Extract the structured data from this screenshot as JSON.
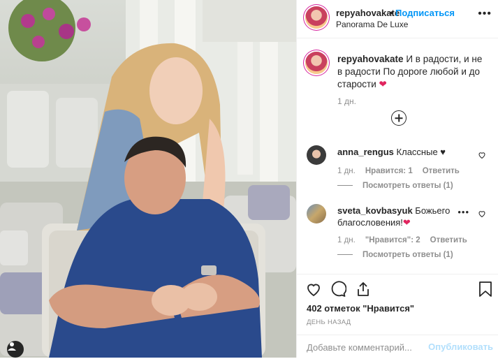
{
  "post": {
    "username": "repyahovakate",
    "separator": "•",
    "follow_label": "Подписаться",
    "location": "Panorama De Luxe",
    "more_icon": "more-dots-icon"
  },
  "caption": {
    "username": "repyahovakate",
    "text": " И в радости, и не в радости По дороге любой и до старости ",
    "emoji": "❤",
    "time": "1 дн.",
    "heart_color": "#e0245e"
  },
  "comments": [
    {
      "username": "anna_rengus",
      "text": " Классные ♥",
      "time": "1 дн.",
      "likes": "Нравится: 1",
      "reply": "Ответить",
      "view_replies": "Посмотреть ответы (1)"
    },
    {
      "username": "sveta_kovbasyuk",
      "text": " Божьего благословения!",
      "emoji": "❤",
      "time": "1 дн.",
      "likes": "\"Нравится\": 2",
      "reply": "Ответить",
      "view_replies": "Посмотреть ответы (1)"
    }
  ],
  "likes_count": "402 отметок \"Нравится\"",
  "date_label": "ДЕНЬ НАЗАД",
  "add_comment": {
    "placeholder": "Добавьте комментарий...",
    "publish_label": "Опубликовать"
  },
  "colors": {
    "link": "#0095f6",
    "muted": "#8e8e8e",
    "publish_disabled": "#b2dffc",
    "text": "#262626"
  }
}
